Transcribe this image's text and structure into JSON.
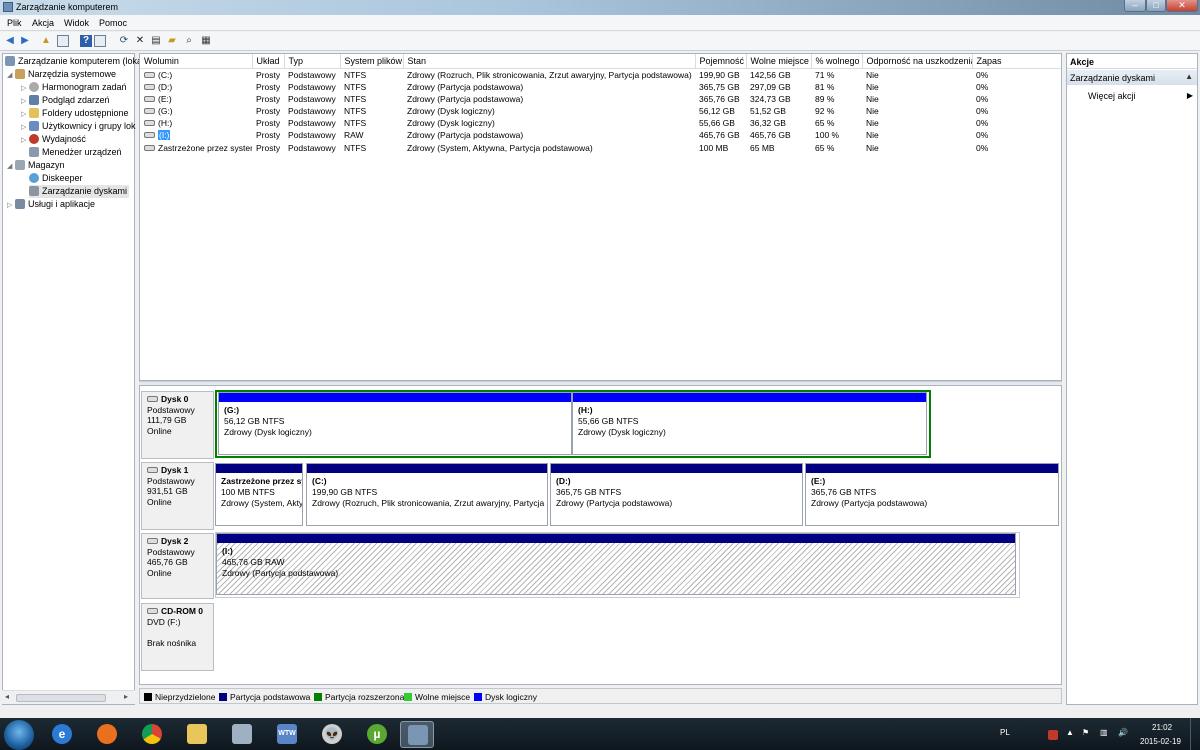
{
  "window": {
    "title": "Zarządzanie komputerem",
    "min": "–",
    "max": "□",
    "close": "✕"
  },
  "menu": [
    "Plik",
    "Akcja",
    "Widok",
    "Pomoc"
  ],
  "tree": {
    "root": "Zarządzanie komputerem (lokal",
    "system_tools": "Narzędzia systemowe",
    "task_scheduler": "Harmonogram zadań",
    "event_viewer": "Podgląd zdarzeń",
    "shared_folders": "Foldery udostępnione",
    "users_groups": "Użytkownicy i grupy lok",
    "performance": "Wydajność",
    "device_manager": "Menedżer urządzeń",
    "storage": "Magazyn",
    "diskeeper": "Diskeeper",
    "disk_management": "Zarządzanie dyskami",
    "services": "Usługi i aplikacje"
  },
  "volumes": {
    "headers": [
      "Wolumin",
      "Układ",
      "Typ",
      "System plików",
      "Stan",
      "Pojemność",
      "Wolne miejsce",
      "% wolnego",
      "Odporność na uszkodzenia",
      "Zapas"
    ],
    "rows": [
      {
        "name": "(C:)",
        "layout": "Prosty",
        "type": "Podstawowy",
        "fs": "NTFS",
        "status": "Zdrowy (Rozruch, Plik stronicowania, Zrzut awaryjny, Partycja podstawowa)",
        "capacity": "199,90 GB",
        "free": "142,56 GB",
        "pct": "71 %",
        "ft": "Nie",
        "overhead": "0%"
      },
      {
        "name": "(D:)",
        "layout": "Prosty",
        "type": "Podstawowy",
        "fs": "NTFS",
        "status": "Zdrowy (Partycja podstawowa)",
        "capacity": "365,75 GB",
        "free": "297,09 GB",
        "pct": "81 %",
        "ft": "Nie",
        "overhead": "0%"
      },
      {
        "name": "(E:)",
        "layout": "Prosty",
        "type": "Podstawowy",
        "fs": "NTFS",
        "status": "Zdrowy (Partycja podstawowa)",
        "capacity": "365,76 GB",
        "free": "324,73 GB",
        "pct": "89 %",
        "ft": "Nie",
        "overhead": "0%"
      },
      {
        "name": "(G:)",
        "layout": "Prosty",
        "type": "Podstawowy",
        "fs": "NTFS",
        "status": "Zdrowy (Dysk logiczny)",
        "capacity": "56,12 GB",
        "free": "51,52 GB",
        "pct": "92 %",
        "ft": "Nie",
        "overhead": "0%"
      },
      {
        "name": "(H:)",
        "layout": "Prosty",
        "type": "Podstawowy",
        "fs": "NTFS",
        "status": "Zdrowy (Dysk logiczny)",
        "capacity": "55,66 GB",
        "free": "36,32 GB",
        "pct": "65 %",
        "ft": "Nie",
        "overhead": "0%"
      },
      {
        "name": "(I:)",
        "layout": "Prosty",
        "type": "Podstawowy",
        "fs": "RAW",
        "status": "Zdrowy (Partycja podstawowa)",
        "capacity": "465,76 GB",
        "free": "465,76 GB",
        "pct": "100 %",
        "ft": "Nie",
        "overhead": "0%"
      },
      {
        "name": "Zastrzeżone przez system",
        "layout": "Prosty",
        "type": "Podstawowy",
        "fs": "NTFS",
        "status": "Zdrowy (System, Aktywna, Partycja podstawowa)",
        "capacity": "100 MB",
        "free": "65 MB",
        "pct": "65 %",
        "ft": "Nie",
        "overhead": "0%"
      }
    ]
  },
  "disks": [
    {
      "name": "Dysk 0",
      "type": "Podstawowy",
      "size": "111,79 GB",
      "state": "Online",
      "partitions": [
        {
          "label": "(G:)",
          "size": "56,12 GB NTFS",
          "status": "Zdrowy (Dysk logiczny)"
        },
        {
          "label": "(H:)",
          "size": "55,66 GB NTFS",
          "status": "Zdrowy (Dysk logiczny)"
        }
      ]
    },
    {
      "name": "Dysk 1",
      "type": "Podstawowy",
      "size": "931,51 GB",
      "state": "Online",
      "partitions": [
        {
          "label": "Zastrzeżone przez sy",
          "size": "100 MB NTFS",
          "status": "Zdrowy (System, Akty"
        },
        {
          "label": "(C:)",
          "size": "199,90 GB NTFS",
          "status": "Zdrowy (Rozruch, Plik stronicowania, Zrzut awaryjny, Partycja"
        },
        {
          "label": "(D:)",
          "size": "365,75 GB NTFS",
          "status": "Zdrowy (Partycja podstawowa)"
        },
        {
          "label": "(E:)",
          "size": "365,76 GB NTFS",
          "status": "Zdrowy (Partycja podstawowa)"
        }
      ]
    },
    {
      "name": "Dysk 2",
      "type": "Podstawowy",
      "size": "465,76 GB",
      "state": "Online",
      "partitions": [
        {
          "label": "(I:)",
          "size": "465,76 GB RAW",
          "status": "Zdrowy (Partycja podstawowa)"
        }
      ]
    }
  ],
  "cdrom": {
    "name": "CD-ROM 0",
    "drive": "DVD (F:)",
    "state": "Brak nośnika"
  },
  "legend": [
    {
      "label": "Nieprzydzielone",
      "color": "#000000"
    },
    {
      "label": "Partycja podstawowa",
      "color": "#000080"
    },
    {
      "label": "Partycja rozszerzona",
      "color": "#008000"
    },
    {
      "label": "Wolne miejsce",
      "color": "#33cc33"
    },
    {
      "label": "Dysk logiczny",
      "color": "#0000ff"
    }
  ],
  "actions": {
    "header": "Akcje",
    "section": "Zarządzanie dyskami",
    "more": "Więcej akcji"
  },
  "taskbar": {
    "lang": "PL",
    "time": "21:02",
    "date": "2015-02-19"
  },
  "colors": {
    "selection": "#3399ff",
    "primary_band": "#000080",
    "logical_band": "#0000ff",
    "extended_border": "#008000"
  }
}
